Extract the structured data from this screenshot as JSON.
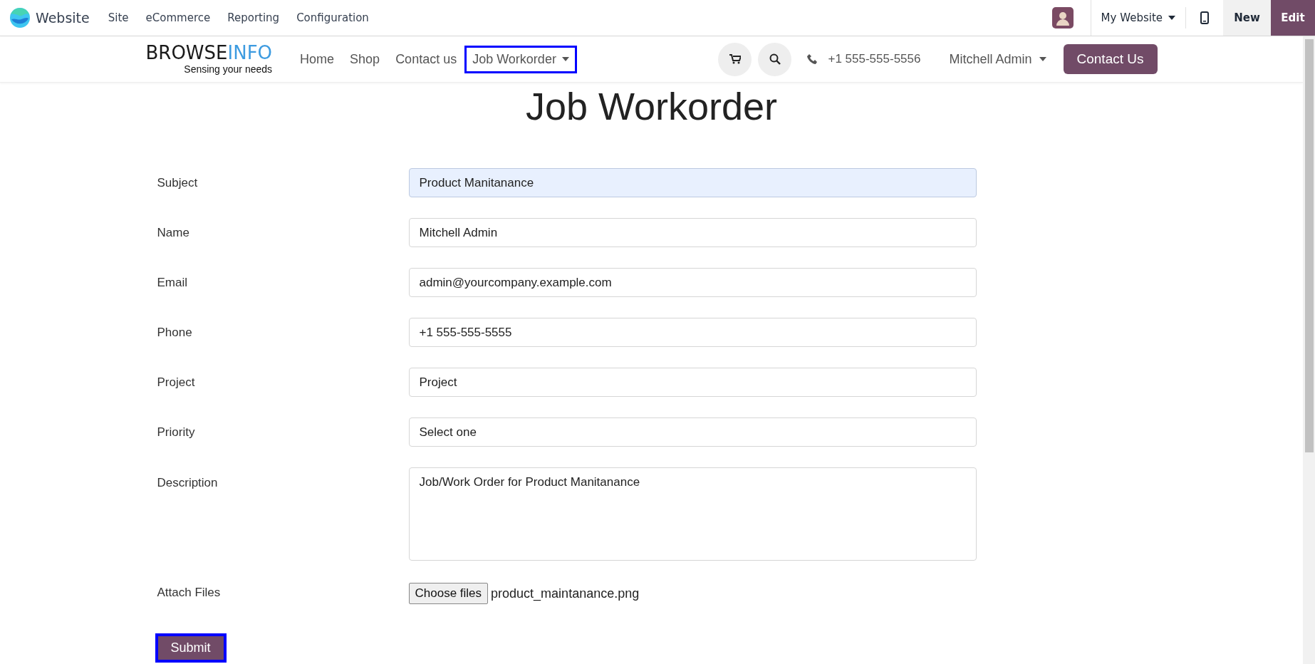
{
  "admin_bar": {
    "app_name": "Website",
    "menu": [
      "Site",
      "eCommerce",
      "Reporting",
      "Configuration"
    ],
    "website_switcher": "My Website",
    "new_button": "New",
    "edit_button": "Edit"
  },
  "site_nav": {
    "logo": {
      "part_1": "BROWSE",
      "part_2": "INFO",
      "tagline": "Sensing your needs"
    },
    "links": [
      {
        "label": "Home",
        "dropdown": false,
        "highlighted": false
      },
      {
        "label": "Shop",
        "dropdown": false,
        "highlighted": false
      },
      {
        "label": "Contact us",
        "dropdown": false,
        "highlighted": false
      },
      {
        "label": "Job Workorder",
        "dropdown": true,
        "highlighted": true
      }
    ],
    "phone": "+1 555-555-5556",
    "user": "Mitchell Admin",
    "cta": "Contact Us"
  },
  "page_title": "Job Workorder",
  "form": {
    "fields": [
      {
        "kind": "text",
        "label": "Subject",
        "value": "Product Manitanance",
        "autofilled": true
      },
      {
        "kind": "text",
        "label": "Name",
        "value": "Mitchell Admin",
        "autofilled": false
      },
      {
        "kind": "text",
        "label": "Email",
        "value": "admin@yourcompany.example.com",
        "autofilled": false
      },
      {
        "kind": "text",
        "label": "Phone",
        "value": "+1 555-555-5555",
        "autofilled": false
      },
      {
        "kind": "text",
        "label": "Project",
        "value": "Project",
        "autofilled": false
      },
      {
        "kind": "select",
        "label": "Priority",
        "value": "Select one",
        "autofilled": false
      },
      {
        "kind": "textarea",
        "label": "Description",
        "value": "Job/Work Order for Product Manitanance",
        "autofilled": false
      },
      {
        "kind": "file",
        "label": "Attach Files",
        "button": "Choose files",
        "value": "product_maintanance.png"
      }
    ],
    "submit": {
      "label": "Submit",
      "highlighted": true
    }
  }
}
